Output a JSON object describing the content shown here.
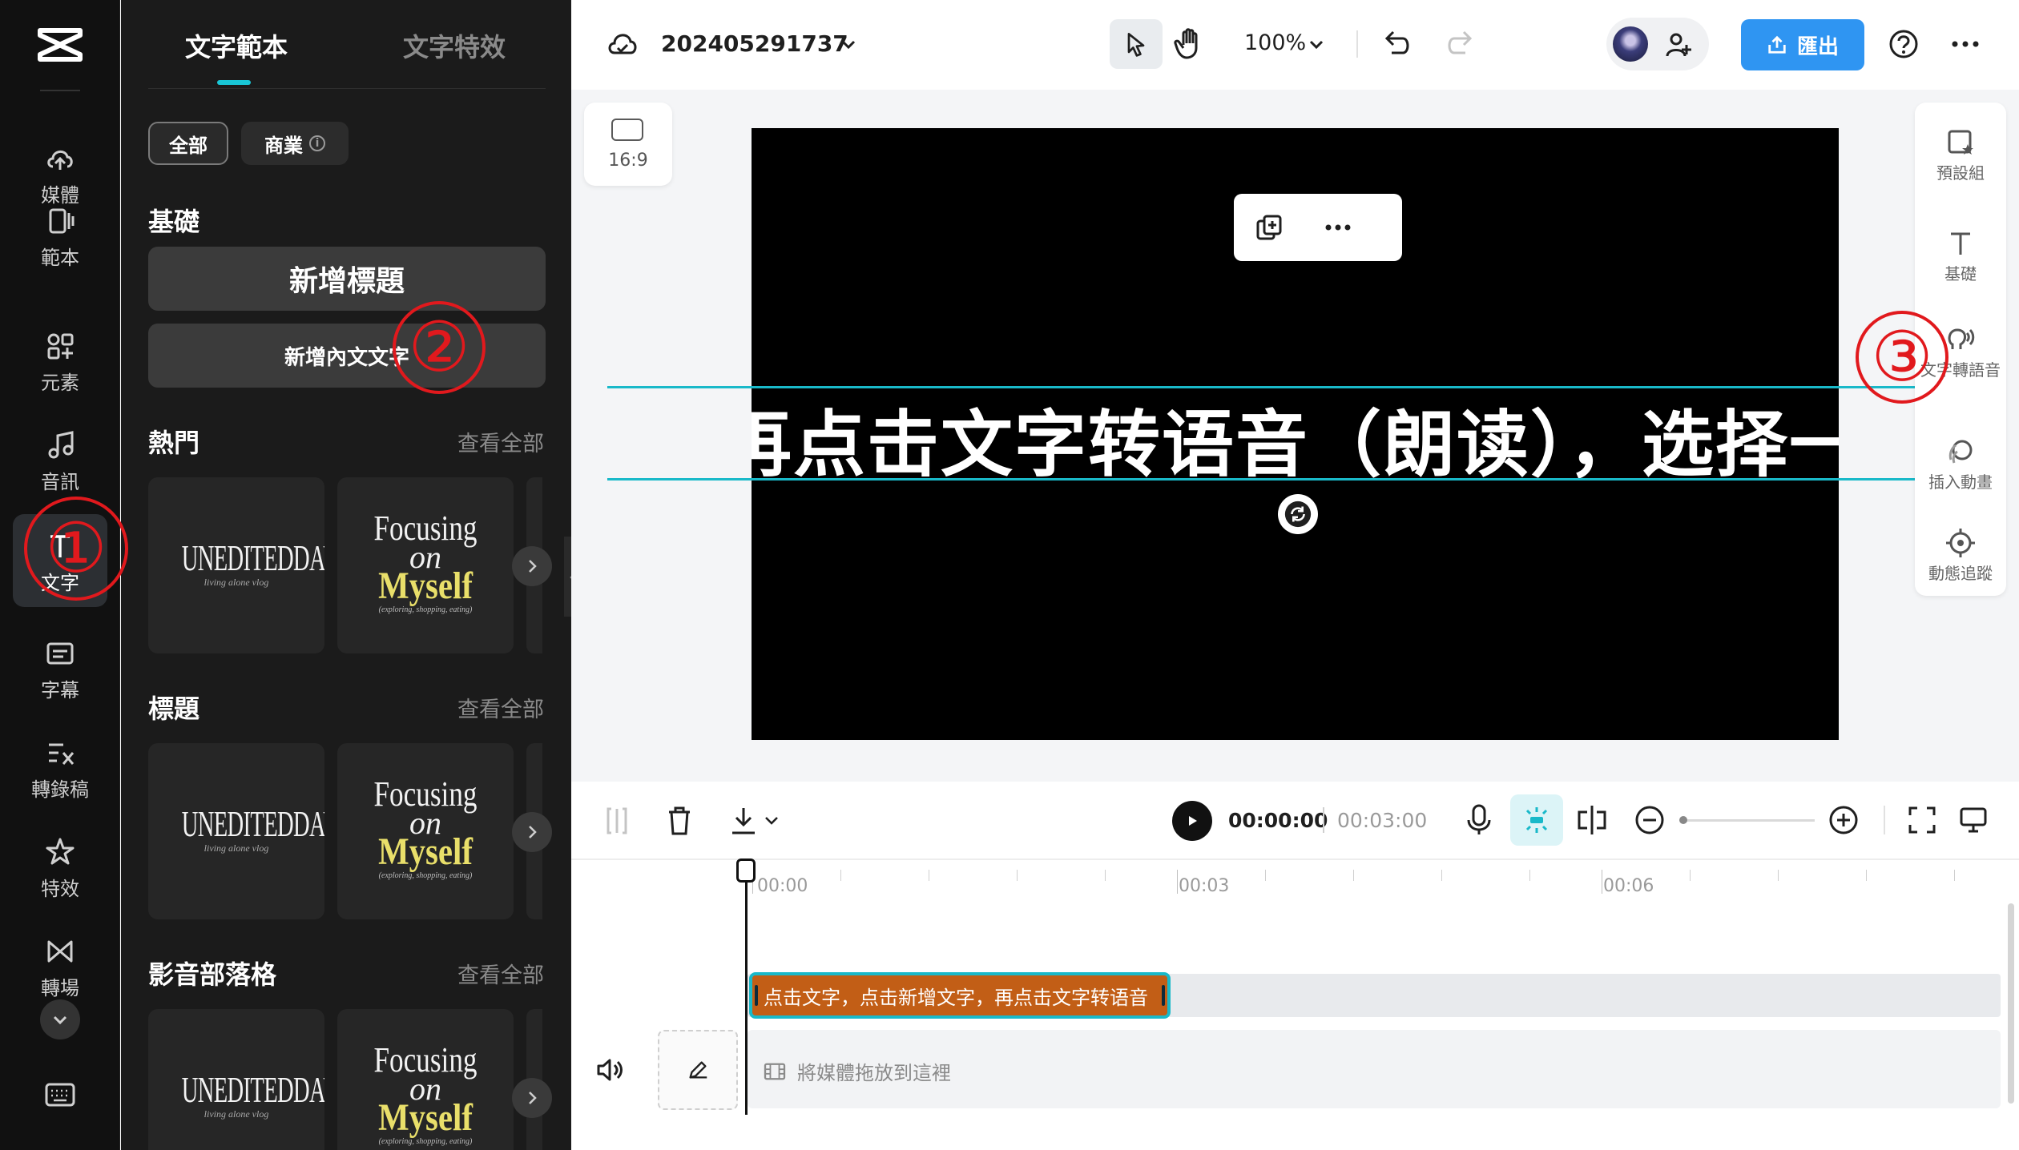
{
  "sidebar": {
    "items": [
      {
        "label": "媒體",
        "icon": "cloud-upload-icon"
      },
      {
        "label": "範本",
        "icon": "template-icon"
      },
      {
        "label": "元素",
        "icon": "elements-icon"
      },
      {
        "label": "音訊",
        "icon": "music-icon"
      },
      {
        "label": "文字",
        "icon": "text-icon",
        "active": true
      },
      {
        "label": "字幕",
        "icon": "subtitles-icon"
      },
      {
        "label": "轉錄稿",
        "icon": "transcript-icon"
      },
      {
        "label": "特效",
        "icon": "effects-icon"
      },
      {
        "label": "轉場",
        "icon": "transition-icon"
      }
    ]
  },
  "panel": {
    "tabs": [
      "文字範本",
      "文字特效"
    ],
    "active_tab": 0,
    "chips": [
      "全部",
      "商業"
    ],
    "basic": {
      "title": "基礎",
      "add_title": "新增標題",
      "add_body": "新增內文文字"
    },
    "sections": [
      {
        "title": "熱門",
        "see_all": "查看全部"
      },
      {
        "title": "標題",
        "see_all": "查看全部"
      },
      {
        "title": "影音部落格",
        "see_all": "查看全部"
      }
    ],
    "template_a": {
      "line1": "UNEDITEDDAY",
      "line2": "living alone vlog"
    },
    "template_b": {
      "line1": "Focusing",
      "line2": "on",
      "line3": "Myself",
      "line4": "(exploring, shopping, eating)"
    }
  },
  "topbar": {
    "project_name": "202405291737",
    "zoom": "100%",
    "export_label": "匯出"
  },
  "stage": {
    "ratio": "16:9",
    "caption": "再点击文字转语音（朗读），选择一"
  },
  "right_tools": [
    {
      "label": "預設組",
      "icon": "preset-icon"
    },
    {
      "label": "基礎",
      "icon": "text-basic-icon"
    },
    {
      "label": "文字轉語音",
      "icon": "text-to-speech-icon"
    },
    {
      "label": "插入動畫",
      "icon": "animation-icon"
    },
    {
      "label": "動態追蹤",
      "icon": "tracking-icon"
    }
  ],
  "annotations": [
    "①",
    "②",
    "③"
  ],
  "timeline": {
    "current_time": "00:00:00",
    "total_time": "00:03:00",
    "ruler": [
      "00:00",
      "00:03",
      "00:06"
    ],
    "text_clip": "点击文字，点击新增文字，再点击文字转语音",
    "drop_hint": "將媒體拖放到這裡"
  },
  "colors": {
    "accent": "#19c6d6",
    "export": "#2f95f2",
    "clip": "#c25e16",
    "annotation": "#e1191d"
  }
}
